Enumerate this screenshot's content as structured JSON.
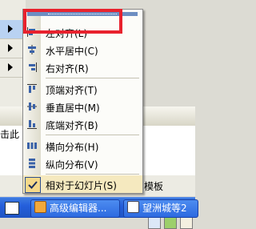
{
  "background": {
    "left_sliver_text": "击此",
    "right_template_text": "+模板"
  },
  "menu": {
    "items": [
      {
        "label": "左对齐(L)",
        "icon": "align-left-icon"
      },
      {
        "label": "水平居中(C)",
        "icon": "align-center-icon"
      },
      {
        "label": "右对齐(R)",
        "icon": "align-right-icon"
      },
      {
        "label": "顶端对齐(T)",
        "icon": "align-top-icon"
      },
      {
        "label": "垂直居中(M)",
        "icon": "align-middle-icon"
      },
      {
        "label": "底端对齐(B)",
        "icon": "align-bottom-icon"
      },
      {
        "label": "横向分布(H)",
        "icon": "distribute-horizontal-icon"
      },
      {
        "label": "纵向分布(V)",
        "icon": "distribute-vertical-icon"
      },
      {
        "label": "相对于幻灯片(S)",
        "icon": "check-icon",
        "checked": true
      }
    ]
  },
  "taskbar": {
    "buttons": [
      {
        "label": "高级编辑器..."
      },
      {
        "label": "望洲城等2"
      }
    ]
  },
  "colors": {
    "highlight": "#e8222e",
    "taskbar": "#245edb",
    "menu_grip": "#6d8ec2"
  }
}
